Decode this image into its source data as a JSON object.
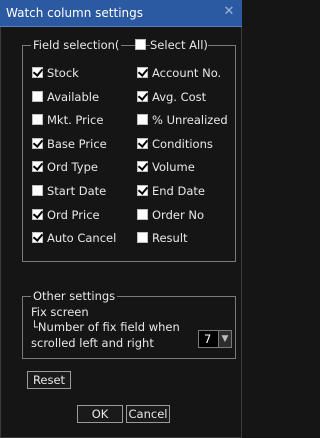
{
  "window": {
    "title": "Watch column settings",
    "close_symbol": "✕"
  },
  "field_selection": {
    "legend_text": "Field selection(",
    "select_all": {
      "label": "Select All)",
      "checked": false
    },
    "left_column": [
      {
        "label": "Stock",
        "checked": true
      },
      {
        "label": "Available",
        "checked": false
      },
      {
        "label": "Mkt. Price",
        "checked": false
      },
      {
        "label": "Base Price",
        "checked": true
      },
      {
        "label": "Ord Type",
        "checked": true
      },
      {
        "label": "Start Date",
        "checked": false
      },
      {
        "label": "Ord Price",
        "checked": true
      },
      {
        "label": "Auto Cancel",
        "checked": true
      }
    ],
    "right_column": [
      {
        "label": "Account No.",
        "checked": true
      },
      {
        "label": "Avg. Cost",
        "checked": true
      },
      {
        "label": "% Unrealized",
        "checked": false
      },
      {
        "label": "Conditions",
        "checked": true
      },
      {
        "label": "Volume",
        "checked": true
      },
      {
        "label": "End Date",
        "checked": true
      },
      {
        "label": "Order No",
        "checked": false
      },
      {
        "label": "Result",
        "checked": false
      }
    ]
  },
  "other_settings": {
    "legend": "Other settings",
    "fix_screen": "Fix screen",
    "fix_field_line1": "└Number of fix field when",
    "fix_field_line2": "scrolled left and right",
    "fix_field_value": "7"
  },
  "buttons": {
    "reset": "Reset",
    "ok": "OK",
    "cancel": "Cancel"
  }
}
